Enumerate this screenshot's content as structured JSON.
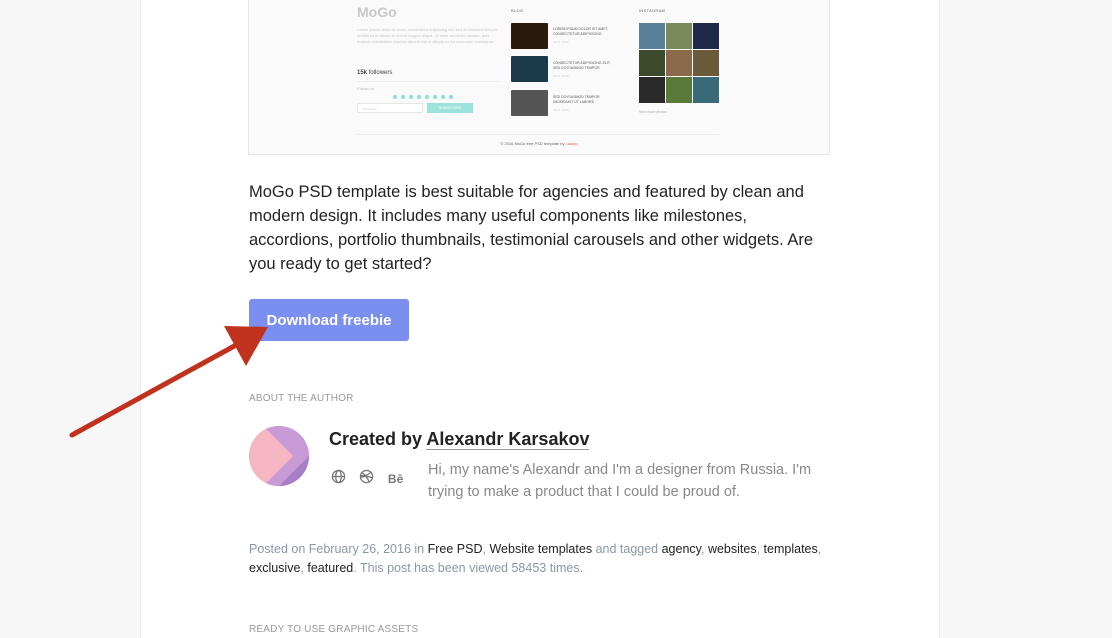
{
  "preview": {
    "logo": "MoGo",
    "intro_text": "Lorem ipsum dolor sit amet, consectetur adipiscing elit, sed do eiusmod tempor incididunt ut labore et dolore magna aliqua. Ut enim ad minim veniam, quis nostrud exercitation ullamco laboris nisi ut aliquip ex ea commodo consequat.",
    "followers_count": "15k",
    "followers_label": "followers",
    "follow_us": "Follow us:",
    "email_placeholder": "Your Email",
    "subscribe_label": "SUBSCRIBE",
    "blog_title": "BLOG",
    "blog_posts": [
      {
        "title": "LOREM IPSUM DOLOR SIT AMET, CONSECTETUR ADIPISICING",
        "date": "Jan 9, 2016",
        "color": "#2a1a0c"
      },
      {
        "title": "CONSECTETUR ADIPISICING ELIT, SED DO EIUSMOD TEMPOR",
        "date": "Jan 9, 2016",
        "color": "#1d3a4a"
      },
      {
        "title": "SED DO EIUSMOD TEMPOR INCIDIDUNT UT LABORE",
        "date": "Jan 9, 2016",
        "color": "#555555"
      }
    ],
    "instagram_title": "INSTAGRAM",
    "instagram_colors": [
      "#5a7f9a",
      "#7a8a5c",
      "#1e2a4a",
      "#3a4a2a",
      "#8a6a4a",
      "#6a5a3a",
      "#2a2a2a",
      "#5a7a3a",
      "#3a6a7a"
    ],
    "view_more": "View more photos",
    "copyright_prefix": "© 2016 MoGo free PSD template by",
    "copyright_author": "Laaqiq"
  },
  "description": "MoGo PSD template is best suitable for agencies and featured by clean and modern design. It includes many useful components like milestones, accordions, portfolio thumbnails, testimonial carousels and other widgets. Are you ready to get started?",
  "download_label": "Download freebie",
  "about_heading": "ABOUT THE AUTHOR",
  "author": {
    "created_by": "Created by",
    "name": "Alexandr Karsakov",
    "bio": "Hi, my name's Alexandr and I'm a designer from Russia. I'm trying to make a product that I could be proud of.",
    "behance_label": "Bē"
  },
  "post_meta": {
    "posted_on": "Posted on February 26, 2016 in",
    "category_1": "Free PSD",
    "separator": ",",
    "category_2": "Website templates",
    "and_tagged": "and tagged",
    "tags": [
      "agency",
      "websites",
      "templates",
      "exclusive",
      "featured"
    ],
    "views_prefix": "This post has been viewed",
    "views_count": "58453",
    "views_suffix": "times."
  },
  "assets_heading": "READY TO USE GRAPHIC ASSETS",
  "colors": {
    "button": "#7b8ff0",
    "arrow": "#c0321e",
    "avatar_pink": "#f4a9b8",
    "avatar_purple": "#b98ad1"
  }
}
